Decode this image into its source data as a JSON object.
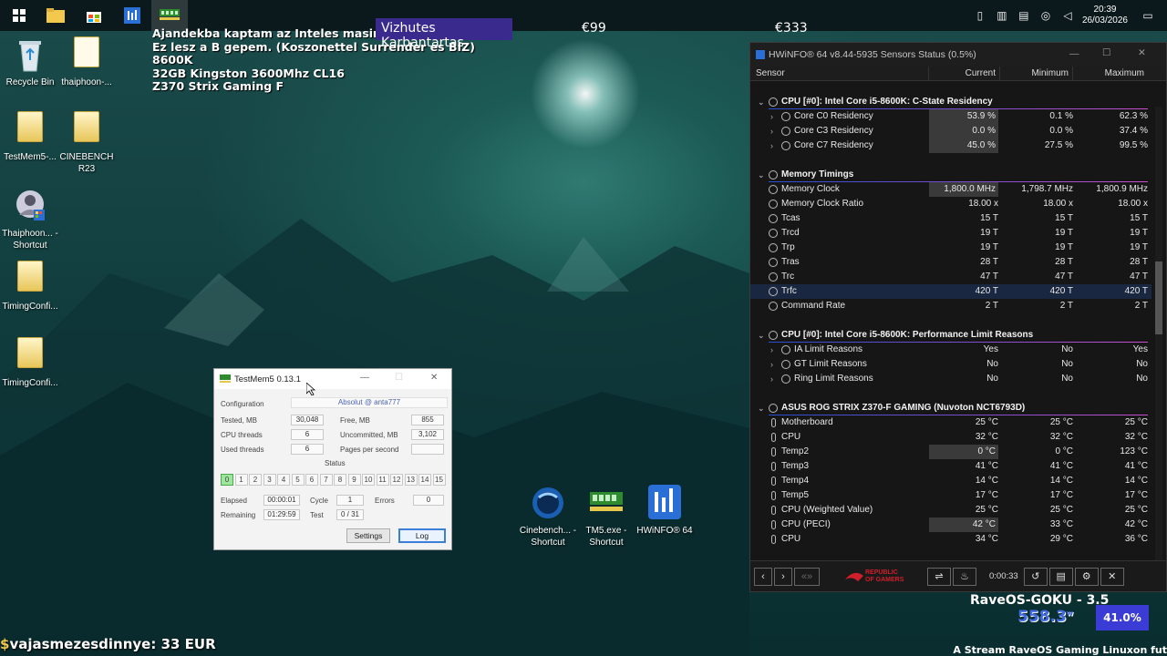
{
  "overlay": {
    "lines": [
      "Ajandekba kaptam az Inteles masinat.",
      "Ez lesz a B gepem. (Koszonettel Surrender es BIZ)",
      "8600K",
      "32GB Kingston 3600Mhz CL16",
      "Z370 Strix Gaming F"
    ],
    "banner": "Vizhutes Karbantartas",
    "price1": "€99",
    "price2": "€333",
    "donation": "vajasmezesdinnye: 33 EUR"
  },
  "taskbar": {
    "time": "20:39",
    "date": "26/03/2026"
  },
  "desktop_icons": [
    {
      "label": "Recycle Bin"
    },
    {
      "label": "thaiphoon-..."
    },
    {
      "label": "TestMem5-..."
    },
    {
      "label": "CINEBENCH R23"
    },
    {
      "label": "Thaiphoon... - Shortcut"
    },
    {
      "label": "TimingConfi..."
    },
    {
      "label": "TimingConfi..."
    }
  ],
  "shortcuts": [
    {
      "label": "Cinebench... - Shortcut"
    },
    {
      "label": "TM5.exe - Shortcut"
    },
    {
      "label": "HWiNFO® 64"
    }
  ],
  "testmem5": {
    "title": "TestMem5  0.13.1",
    "configuration_label": "Configuration",
    "configuration_value": "Absolut @ anta777",
    "tested_label": "Tested, MB",
    "tested_value": "30,048",
    "free_label": "Free, MB",
    "free_value": "855",
    "cpu_threads_label": "CPU threads",
    "cpu_threads_value": "6",
    "uncommitted_label": "Uncommitted, MB",
    "uncommitted_value": "3,102",
    "used_threads_label": "Used threads",
    "used_threads_value": "6",
    "pages_label": "Pages per second",
    "pages_value": "",
    "status_label": "Status",
    "cells": [
      "0",
      "1",
      "2",
      "3",
      "4",
      "5",
      "6",
      "7",
      "8",
      "9",
      "10",
      "11",
      "12",
      "13",
      "14",
      "15"
    ],
    "active_cell": 0,
    "elapsed_label": "Elapsed",
    "elapsed_value": "00:00:01",
    "cycle_label": "Cycle",
    "cycle_value": "1",
    "errors_label": "Errors",
    "errors_value": "0",
    "remaining_label": "Remaining",
    "remaining_value": "01:29:59",
    "test_label": "Test",
    "test_value": "0 / 31",
    "settings_button": "Settings",
    "log_button": "Log"
  },
  "hwinfo": {
    "title": "HWiNFO® 64 v8.44-5935 Sensors Status (0.5%)",
    "columns": {
      "sensor": "Sensor",
      "current": "Current",
      "minimum": "Minimum",
      "maximum": "Maximum"
    },
    "rows": [
      {
        "type": "sec",
        "name": "CPU [#0]: Intel Core i5-8600K: C-State Residency"
      },
      {
        "type": "sub",
        "name": "Core C0 Residency",
        "cur": "53.9 %",
        "min": "0.1 %",
        "max": "62.3 %",
        "hl": true
      },
      {
        "type": "sub",
        "name": "Core C3 Residency",
        "cur": "0.0 %",
        "min": "0.0 %",
        "max": "37.4 %",
        "hl": true
      },
      {
        "type": "sub",
        "name": "Core C7 Residency",
        "cur": "45.0 %",
        "min": "27.5 %",
        "max": "99.5 %",
        "hl": true
      },
      {
        "type": "gap"
      },
      {
        "type": "sec",
        "name": "Memory Timings"
      },
      {
        "type": "clk",
        "name": "Memory Clock",
        "cur": "1,800.0 MHz",
        "min": "1,798.7 MHz",
        "max": "1,800.9 MHz",
        "hl": true
      },
      {
        "type": "clk",
        "name": "Memory Clock Ratio",
        "cur": "18.00 x",
        "min": "18.00 x",
        "max": "18.00 x"
      },
      {
        "type": "clk",
        "name": "Tcas",
        "cur": "15 T",
        "min": "15 T",
        "max": "15 T"
      },
      {
        "type": "clk",
        "name": "Trcd",
        "cur": "19 T",
        "min": "19 T",
        "max": "19 T"
      },
      {
        "type": "clk",
        "name": "Trp",
        "cur": "19 T",
        "min": "19 T",
        "max": "19 T"
      },
      {
        "type": "clk",
        "name": "Tras",
        "cur": "28 T",
        "min": "28 T",
        "max": "28 T"
      },
      {
        "type": "clk",
        "name": "Trc",
        "cur": "47 T",
        "min": "47 T",
        "max": "47 T"
      },
      {
        "type": "clk",
        "name": "Trfc",
        "cur": "420 T",
        "min": "420 T",
        "max": "420 T",
        "sel": true
      },
      {
        "type": "clk",
        "name": "Command Rate",
        "cur": "2 T",
        "min": "2 T",
        "max": "2 T"
      },
      {
        "type": "gap"
      },
      {
        "type": "sec",
        "name": "CPU [#0]: Intel Core i5-8600K: Performance Limit Reasons"
      },
      {
        "type": "sub",
        "name": "IA Limit Reasons",
        "cur": "Yes",
        "min": "No",
        "max": "Yes"
      },
      {
        "type": "sub",
        "name": "GT Limit Reasons",
        "cur": "No",
        "min": "No",
        "max": "No"
      },
      {
        "type": "sub",
        "name": "Ring Limit Reasons",
        "cur": "No",
        "min": "No",
        "max": "No"
      },
      {
        "type": "gap"
      },
      {
        "type": "sec",
        "name": "ASUS ROG STRIX Z370-F GAMING (Nuvoton NCT6793D)"
      },
      {
        "type": "tmp",
        "name": "Motherboard",
        "cur": "25 °C",
        "min": "25 °C",
        "max": "25 °C"
      },
      {
        "type": "tmp",
        "name": "CPU",
        "cur": "32 °C",
        "min": "32 °C",
        "max": "32 °C"
      },
      {
        "type": "tmp",
        "name": "Temp2",
        "cur": "0 °C",
        "min": "0 °C",
        "max": "123 °C",
        "hl": true
      },
      {
        "type": "tmp",
        "name": "Temp3",
        "cur": "41 °C",
        "min": "41 °C",
        "max": "41 °C"
      },
      {
        "type": "tmp",
        "name": "Temp4",
        "cur": "14 °C",
        "min": "14 °C",
        "max": "14 °C"
      },
      {
        "type": "tmp",
        "name": "Temp5",
        "cur": "17 °C",
        "min": "17 °C",
        "max": "17 °C"
      },
      {
        "type": "tmp",
        "name": "CPU (Weighted Value)",
        "cur": "25 °C",
        "min": "25 °C",
        "max": "25 °C"
      },
      {
        "type": "tmp",
        "name": "CPU (PECI)",
        "cur": "42 °C",
        "min": "33 °C",
        "max": "42 °C",
        "hl": true
      },
      {
        "type": "tmp",
        "name": "CPU",
        "cur": "34 °C",
        "min": "29 °C",
        "max": "36 °C"
      }
    ],
    "footer_time": "0:00:33",
    "logo_text": "REPUBLIC OF GAMERS"
  },
  "raveos": {
    "title": "RaveOS-GOKU - 3.5",
    "power": "558.3",
    "power_unit": "w",
    "percent": "41.0%",
    "ticker": "A Stream RaveOS Gaming Linuxon fut"
  }
}
